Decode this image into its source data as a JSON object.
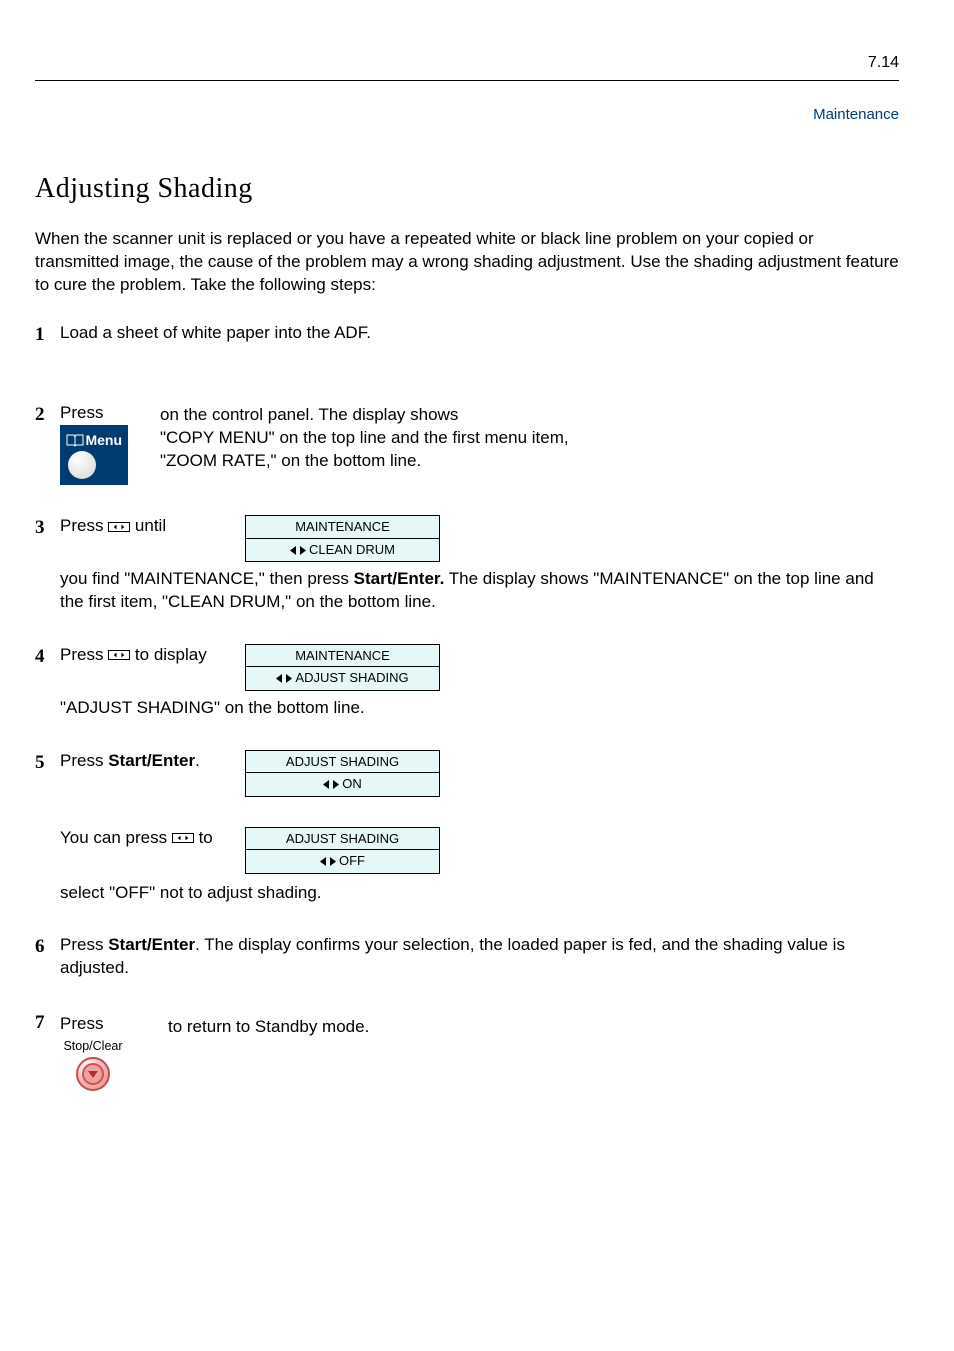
{
  "page_number_top": "7.14",
  "chapter_header": "Maintenance",
  "section_title": "Adjusting Shading",
  "intro_text": "When the scanner unit is replaced or you have a repeated white or black line problem on your copied or transmitted image, the cause of the problem may a wrong shading adjustment. Use the shading adjustment feature to cure the problem. Take the following steps:",
  "steps": [
    {
      "num": "1",
      "text": "Load a sheet of white paper into the ADF."
    },
    {
      "num": "2",
      "text_before": "Press ",
      "btn_label": "Menu",
      "text_after": " on the control panel. The display shows\n\"COPY MENU\" on the top line and the first menu item,\n\"ZOOM RATE,\" on the bottom line."
    },
    {
      "num": "3",
      "text_before": "Press ",
      "btn_inline": "scroll",
      "text_after": " until you find \"MAINTENANCE,\" then press Start/Enter. The display shows \"MAINTENANCE\" on the top line and the first item, \"CLEAN DRUM,\" on the bottom line.",
      "lcd": {
        "line1": "MAINTENANCE",
        "line2_after": "CLEAN DRUM"
      }
    },
    {
      "num": "4",
      "text": "Press ",
      "scroll_then": " to display \"ADJUST SHADING\" on the bottom line.",
      "lcd": {
        "line1": "MAINTENANCE",
        "line2_after": "ADJUST SHADING"
      }
    },
    {
      "num": "5",
      "text": "Press Start/Enter.",
      "lcd": {
        "line1": "ADJUST SHADING",
        "line2_after": "ON"
      },
      "post_text": "You can press ",
      "post_scroll_then": " to select \"OFF\" not to adjust shading.",
      "lcd2": {
        "line1": "ADJUST SHADING",
        "line2_after": "OFF"
      }
    },
    {
      "num": "6",
      "text": "Press Start/Enter. The display confirms your selection, the loaded paper is fed, and the shading value is adjusted."
    },
    {
      "num": "7",
      "btn_label": "Stop/Clear",
      "text_before": "Press ",
      "text_after": " to return to Standby mode."
    }
  ],
  "icons": {
    "menu_label": "Menu",
    "stop_label": "Stop/Clear"
  }
}
